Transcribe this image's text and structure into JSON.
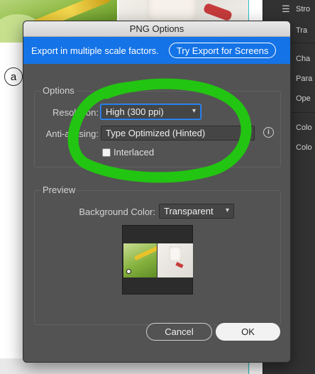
{
  "background": {
    "badge_letter": "a"
  },
  "right_panel": {
    "items": [
      {
        "label": "Stro",
        "icon": "hamburger-icon"
      },
      {
        "label": "Tra",
        "icon": "transform-icon"
      },
      {
        "label": "Cha",
        "icon": "character-icon"
      },
      {
        "label": "Para",
        "icon": "paragraph-icon"
      },
      {
        "label": "Ope",
        "icon": "opentype-icon"
      },
      {
        "label": "Colo",
        "icon": "color-icon"
      },
      {
        "label": "Colo",
        "icon": "color-guide-icon"
      }
    ]
  },
  "dialog": {
    "title": "PNG Options",
    "banner": {
      "text": "Export in multiple scale factors.",
      "button": "Try Export for Screens",
      "color": "#1473e6"
    },
    "options": {
      "legend": "Options",
      "resolution_label": "Resolution:",
      "resolution_value": "High (300 ppi)",
      "antialias_label": "Anti-aliasing:",
      "antialias_value": "Type Optimized (Hinted)",
      "interlaced_label": "Interlaced",
      "interlaced_checked": false
    },
    "preview": {
      "legend": "Preview",
      "bg_color_label": "Background Color:",
      "bg_color_value": "Transparent"
    },
    "buttons": {
      "cancel": "Cancel",
      "ok": "OK"
    }
  },
  "annotation": {
    "color": "#22c511"
  }
}
